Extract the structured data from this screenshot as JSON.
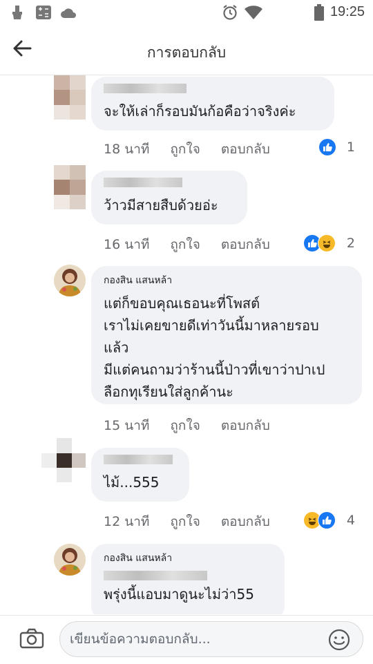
{
  "status_bar": {
    "time": "19:25"
  },
  "header": {
    "title": "การตอบกลับ"
  },
  "comments": [
    {
      "name": "",
      "text": "จะให้เล่าก็รอบมันก้อคือว่าจริงค่ะ",
      "time": "18 นาที",
      "like_label": "ถูกใจ",
      "reply_label": "ตอบกลับ",
      "reaction_count": "1",
      "reactions": [
        "like"
      ]
    },
    {
      "name": "",
      "text": "ว้าวมีสายสืบด้วยอ่ะ",
      "time": "16 นาที",
      "like_label": "ถูกใจ",
      "reply_label": "ตอบกลับ",
      "reaction_count": "2",
      "reactions": [
        "like",
        "haha"
      ]
    },
    {
      "name": "กองสิน แสนหล้า",
      "text": "แต่ก็ขอบคุณเธอนะที่โพสต์\nเราไม่เคยขายดีเท่าวันนี้มาหลายรอบ\nแล้ว\nมีแต่คนถามว่าร้านนี้ป่าวที่เขาว่าปาเป\nลือกทุเรียนใส่ลูกค้านะ",
      "time": "15 นาที",
      "like_label": "ถูกใจ",
      "reply_label": "ตอบกลับ"
    },
    {
      "name": "",
      "text": "ไม้...555",
      "time": "12 นาที",
      "like_label": "ถูกใจ",
      "reply_label": "ตอบกลับ",
      "reaction_count": "4",
      "reactions": [
        "haha",
        "like"
      ]
    },
    {
      "name": "กองสิน แสนหล้า",
      "text": "พรุ่งนี้แอบมาดูนะไม่ว่า55"
    }
  ],
  "composer": {
    "placeholder": "เขียนข้อความตอบกลับ..."
  },
  "colors": {
    "like_blue": "#1877f2",
    "haha_yellow": "#f7b928",
    "bubble_bg": "#f0f2f5",
    "meta_gray": "#65676b"
  },
  "icons": [
    "brush-icon",
    "calculator-icon",
    "cloud-icon",
    "alarm-icon",
    "wifi-icon",
    "battery-icon",
    "back-arrow-icon",
    "camera-icon",
    "smiley-icon",
    "like-reaction-icon",
    "haha-reaction-icon"
  ]
}
